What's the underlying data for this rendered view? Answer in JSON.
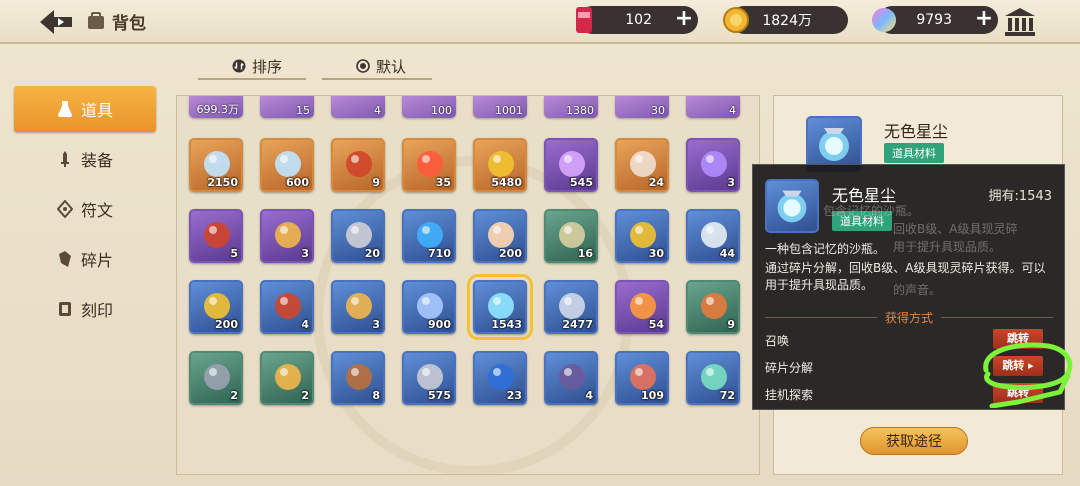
{
  "header": {
    "title": "背包",
    "resources": [
      {
        "icon": "stamina-can-icon",
        "value": "102"
      },
      {
        "icon": "gold-coin-icon",
        "value": "1824万"
      },
      {
        "icon": "rainbow-gem-icon",
        "value": "9793"
      }
    ],
    "plus_label": "+"
  },
  "sort": {
    "sort_label": "排序",
    "default_label": "默认"
  },
  "sidebar": {
    "items": [
      {
        "label": "道具",
        "icon": "flask-icon",
        "active": true
      },
      {
        "label": "装备",
        "icon": "sword-icon",
        "active": false
      },
      {
        "label": "符文",
        "icon": "rune-icon",
        "active": false
      },
      {
        "label": "碎片",
        "icon": "shard-icon",
        "active": false
      },
      {
        "label": "刻印",
        "icon": "seal-icon",
        "active": false
      }
    ]
  },
  "grid": {
    "partial_row": [
      "699.3万",
      "15",
      "4",
      "100",
      "1001",
      "1380",
      "30",
      "4"
    ],
    "rows": [
      [
        {
          "icon": "crystal-i-icon",
          "count": "2150",
          "frame": "orange"
        },
        {
          "icon": "crystal-ii-icon",
          "count": "600",
          "frame": "orange"
        },
        {
          "icon": "dynamite-icon",
          "count": "9",
          "frame": "orange"
        },
        {
          "icon": "red-crystal-icon",
          "count": "35",
          "frame": "orange"
        },
        {
          "icon": "star-badge-icon",
          "count": "5480",
          "frame": "orange"
        },
        {
          "icon": "ticket-icon",
          "count": "545",
          "frame": "purple"
        },
        {
          "icon": "robot-cat-icon",
          "count": "24",
          "frame": "orange"
        },
        {
          "icon": "orb-icon",
          "count": "3",
          "frame": "purple"
        }
      ],
      [
        {
          "icon": "dynamite-icon",
          "count": "5",
          "frame": "purple"
        },
        {
          "icon": "key-icon",
          "count": "3",
          "frame": "purple"
        },
        {
          "icon": "tools-icon",
          "count": "20",
          "frame": "blue"
        },
        {
          "icon": "blue-bead-icon",
          "count": "710",
          "frame": "blue"
        },
        {
          "icon": "robot-egg-icon",
          "count": "200",
          "frame": "blue"
        },
        {
          "icon": "cement-bag-icon",
          "count": "16",
          "frame": "green"
        },
        {
          "icon": "coin-token-icon",
          "count": "30",
          "frame": "blue"
        },
        {
          "icon": "shell-icon",
          "count": "44",
          "frame": "blue"
        }
      ],
      [
        {
          "icon": "cross-medal-icon",
          "count": "200",
          "frame": "blue"
        },
        {
          "icon": "dynamite-icon",
          "count": "4",
          "frame": "blue"
        },
        {
          "icon": "key-icon",
          "count": "3",
          "frame": "blue"
        },
        {
          "icon": "gem-icon",
          "count": "900",
          "frame": "blue"
        },
        {
          "icon": "hourglass-icon",
          "count": "1543",
          "frame": "blue",
          "selected": true
        },
        {
          "icon": "silver-medal-icon",
          "count": "2477",
          "frame": "blue"
        },
        {
          "icon": "compass-star-icon",
          "count": "54",
          "frame": "purple"
        },
        {
          "icon": "brush-icon",
          "count": "9",
          "frame": "green"
        }
      ],
      [
        {
          "icon": "hammer-icon",
          "count": "2",
          "frame": "green"
        },
        {
          "icon": "key-icon",
          "count": "2",
          "frame": "green"
        },
        {
          "icon": "bricks-icon",
          "count": "8",
          "frame": "blue"
        },
        {
          "icon": "ore-icon",
          "count": "575",
          "frame": "blue"
        },
        {
          "icon": "blue-shield-icon",
          "count": "23",
          "frame": "blue"
        },
        {
          "icon": "book-icon",
          "count": "4",
          "frame": "blue"
        },
        {
          "icon": "worm-icon",
          "count": "109",
          "frame": "blue"
        },
        {
          "icon": "leaf-icon",
          "count": "72",
          "frame": "blue"
        }
      ]
    ]
  },
  "detail": {
    "name": "无色星尘",
    "tag": "道具材料",
    "obtain_button": "获取途径"
  },
  "tooltip": {
    "name": "无色星尘",
    "owned": "拥有:1543",
    "tag": "道具材料",
    "ghost_lines": [
      "包含记忆的沙瓶。",
      "回收B级、A级具现灵碎",
      "用于提升具现品质。",
      "的声音。"
    ],
    "desc1": "一种包含记忆的沙瓶。",
    "desc2": "通过碎片分解，回收B级、A级具现灵碎片获得。可以用于提升具现品质。",
    "section_title": "获得方式",
    "sources": [
      {
        "label": "召唤",
        "button": "跳转"
      },
      {
        "label": "碎片分解",
        "button": "跳转 ▸"
      },
      {
        "label": "挂机探索",
        "button": "跳转"
      }
    ]
  },
  "colors": {
    "accent": "#f0a23a",
    "highlight_scribble": "#7cf23a",
    "tag_green": "#2fa37a",
    "jump_red": "#b83a22"
  }
}
